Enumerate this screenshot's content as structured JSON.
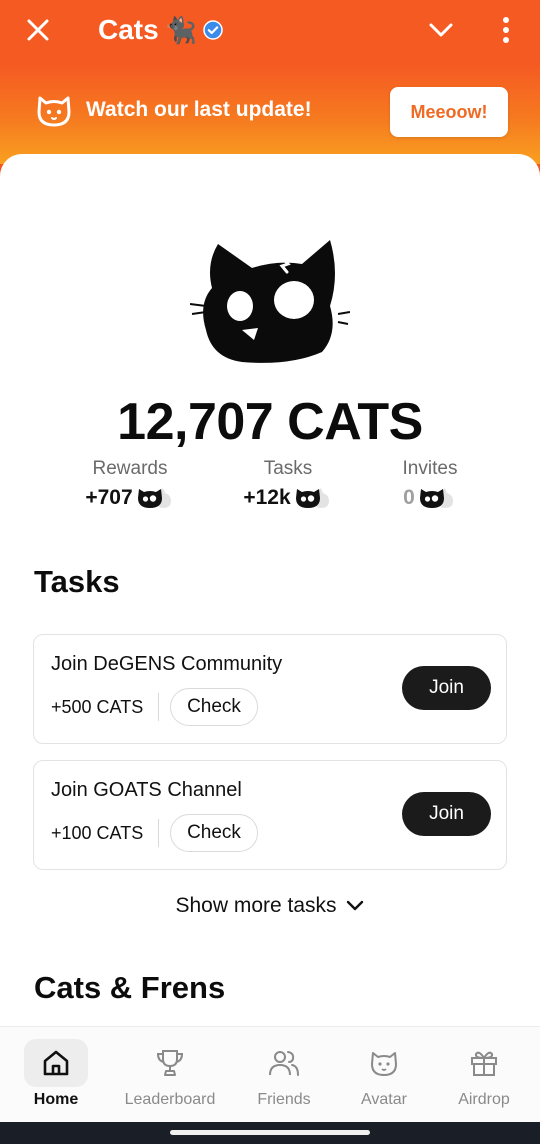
{
  "colors": {
    "brand_orange": "#f45a22",
    "banner_gradient_end": "#f8a020",
    "button_text_orange": "#f06a24",
    "dark": "#1b1b1b",
    "verified_blue": "#3b8beb"
  },
  "header": {
    "title": "Cats",
    "title_emoji": "🐈‍⬛",
    "close_icon": "close-icon",
    "chevron_icon": "chevron-down-icon",
    "menu_icon": "more-vertical-icon",
    "verified_icon": "verified-badge-icon"
  },
  "banner": {
    "text": "Watch our last update!",
    "button_label": "Meeoow!",
    "icon": "cat-face-icon"
  },
  "balance": {
    "total": "12,707 CATS"
  },
  "stats": [
    {
      "label": "Rewards",
      "value": "+707",
      "muted": false
    },
    {
      "label": "Tasks",
      "value": "+12k",
      "muted": false
    },
    {
      "label": "Invites",
      "value": "0",
      "muted": true
    }
  ],
  "tasks_section": {
    "title": "Tasks",
    "items": [
      {
        "name": "Join DeGENS Community",
        "reward": "+500 CATS",
        "check_label": "Check",
        "action_label": "Join"
      },
      {
        "name": "Join GOATS Channel",
        "reward": "+100 CATS",
        "check_label": "Check",
        "action_label": "Join"
      }
    ],
    "show_more": "Show more tasks"
  },
  "frens_section": {
    "title": "Cats & Frens"
  },
  "tabbar": {
    "active": "Home",
    "items": [
      {
        "label": "Home",
        "icon": "home-icon"
      },
      {
        "label": "Leaderboard",
        "icon": "trophy-icon"
      },
      {
        "label": "Friends",
        "icon": "friends-icon"
      },
      {
        "label": "Avatar",
        "icon": "cat-face-icon"
      },
      {
        "label": "Airdrop",
        "icon": "gift-icon"
      }
    ]
  }
}
